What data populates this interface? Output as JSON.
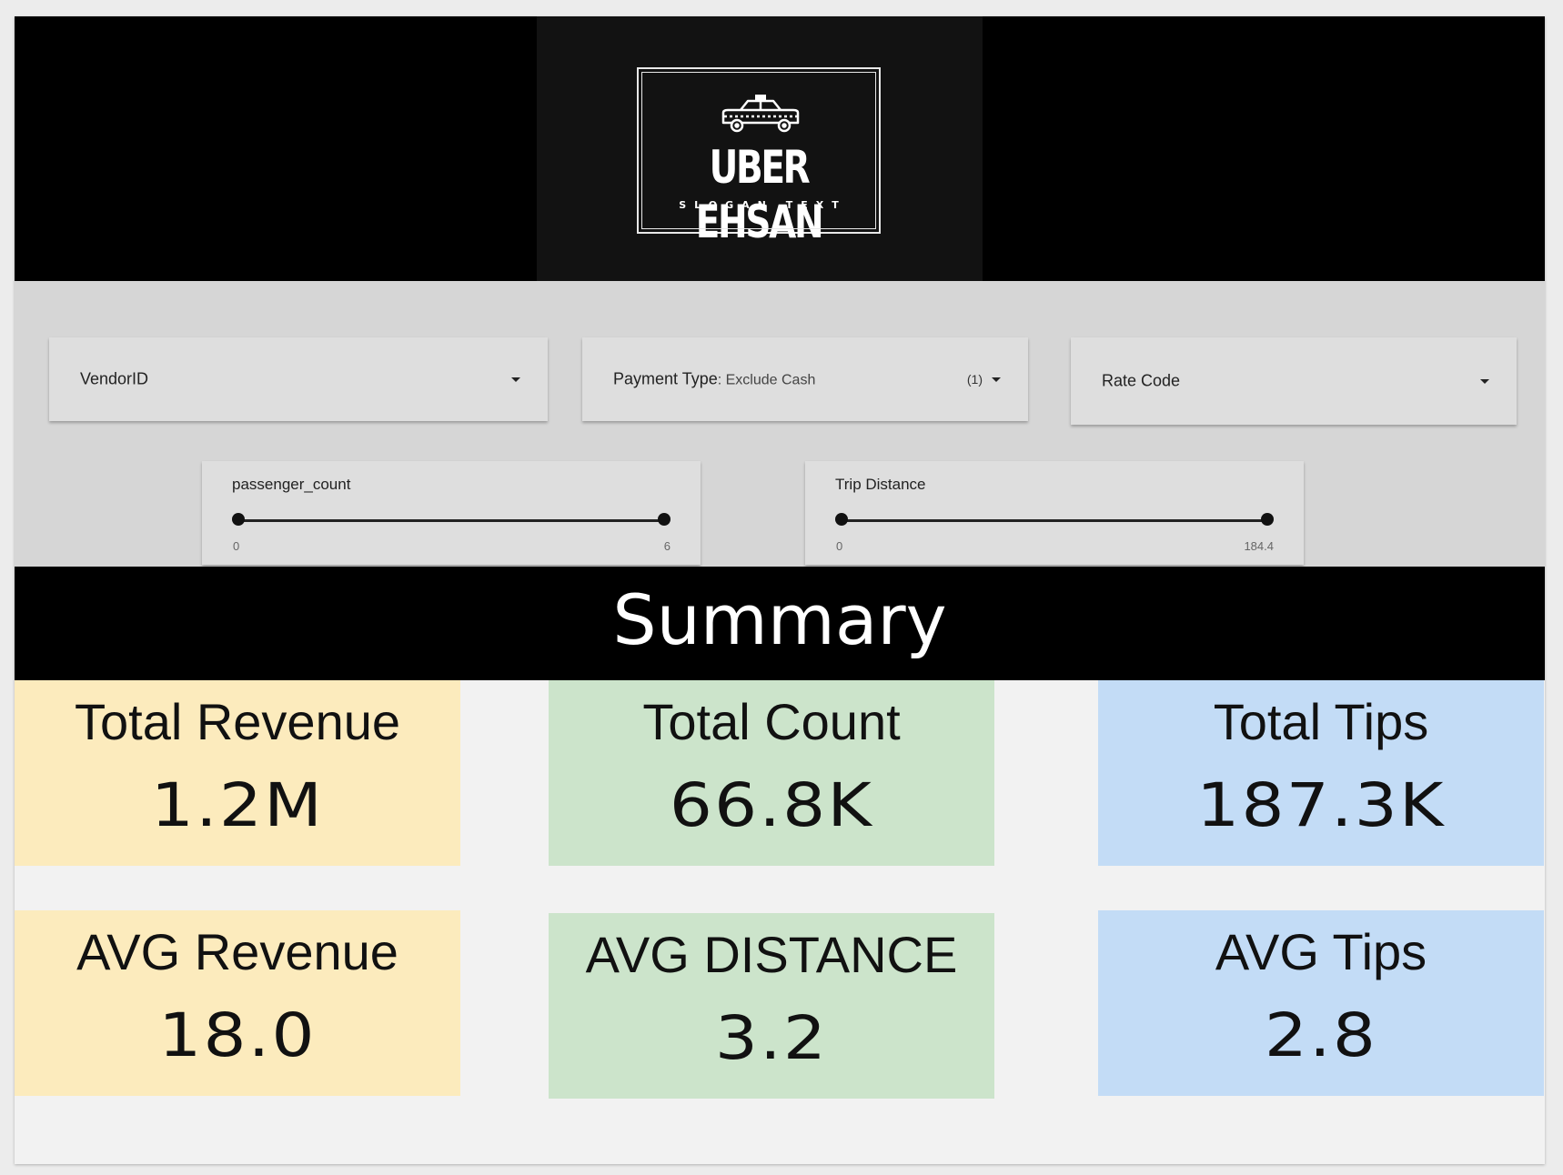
{
  "header": {
    "logo": {
      "icon": "taxi-car-icon",
      "name": "UBER EHSAN",
      "slogan": "SLOGAN TEXT"
    }
  },
  "filters": {
    "vendor": {
      "label": "VendorID"
    },
    "payment": {
      "label": "Payment Type",
      "value": ": Exclude Cash",
      "count": "(1)"
    },
    "rate_code": {
      "label": "Rate Code"
    },
    "passenger_slider": {
      "label": "passenger_count",
      "min": "0",
      "max": "6"
    },
    "distance_slider": {
      "label": "Trip Distance",
      "min": "0",
      "max": "184.4"
    }
  },
  "summary": {
    "title": "Summary",
    "cards": [
      {
        "label": "Total Revenue",
        "value": "1.2M"
      },
      {
        "label": "Total Count",
        "value": "66.8K"
      },
      {
        "label": "Total Tips",
        "value": "187.3K"
      },
      {
        "label": "AVG Revenue",
        "value": "18.0"
      },
      {
        "label": "AVG DISTANCE",
        "value": "3.2"
      },
      {
        "label": "AVG Tips",
        "value": "2.8"
      }
    ]
  },
  "colors": {
    "header_bg": "#000000",
    "logo_panel_bg": "#121212",
    "filter_bg": "#d6d6d6",
    "revenue_card": "#fcebbd",
    "count_card": "#cce4cb",
    "tips_card": "#c3dcf6"
  }
}
